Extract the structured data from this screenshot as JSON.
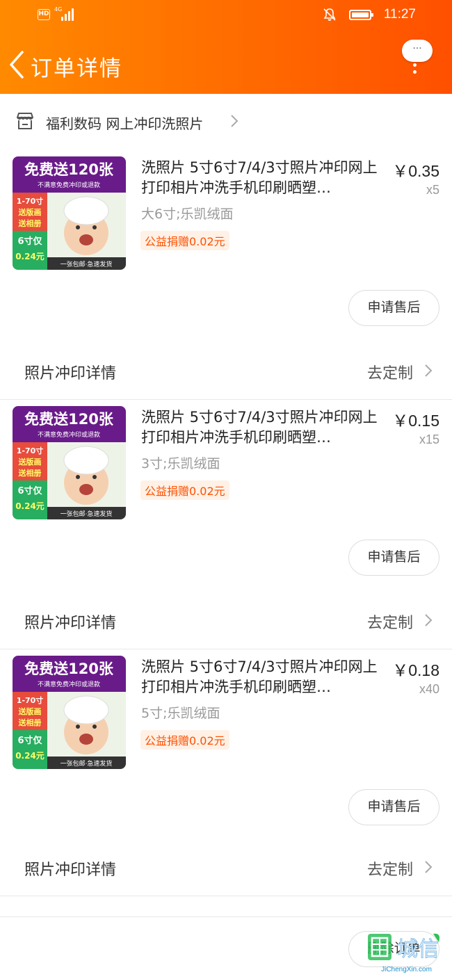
{
  "status_bar": {
    "hd_label": "HD",
    "network_label": "4G",
    "time": "11:27"
  },
  "nav": {
    "title": "订单详情",
    "more_label": "···"
  },
  "shop": {
    "name": "福利数码 网上冲印洗照片"
  },
  "thumbnail": {
    "headline": "免费送120张",
    "subline": "不满意免费冲印或退款",
    "badge1": "1-70寸",
    "badge2": "送版画",
    "badge3": "送相册",
    "badge4": "6寸仅",
    "badge5": "0.24元",
    "footer": "一张包邮·急速发货"
  },
  "items": [
    {
      "title": "洗照片 5寸6寸7/4/3寸照片冲印网上打印相片冲洗手机印刷晒塑…",
      "price": "￥0.35",
      "qty": "x5",
      "spec": "大6寸;乐凯绒面",
      "badge": "公益捐赠0.02元",
      "after_sale": "申请售后",
      "detail_label": "照片冲印详情",
      "detail_link": "去定制"
    },
    {
      "title": "洗照片 5寸6寸7/4/3寸照片冲印网上打印相片冲洗手机印刷晒塑…",
      "price": "￥0.15",
      "qty": "x15",
      "spec": "3寸;乐凯绒面",
      "badge": "公益捐赠0.02元",
      "after_sale": "申请售后",
      "detail_label": "照片冲印详情",
      "detail_link": "去定制"
    },
    {
      "title": "洗照片 5寸6寸7/4/3寸照片冲印网上打印相片冲洗手机印刷晒塑…",
      "price": "￥0.18",
      "qty": "x40",
      "spec": "5寸;乐凯绒面",
      "badge": "公益捐赠0.02元",
      "after_sale": "申请售后",
      "detail_label": "照片冲印详情",
      "detail_link": "去定制"
    }
  ],
  "bottom": {
    "delete_label": "删除订单",
    "watermark_text": "JiChengXin.com",
    "watermark_glyph": "集城信"
  }
}
